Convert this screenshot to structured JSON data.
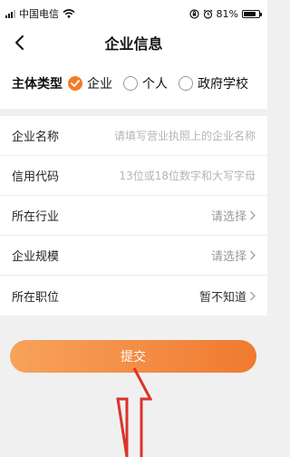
{
  "status_bar": {
    "carrier": "中国电信",
    "battery": "81%",
    "battery_level": 0.81
  },
  "nav": {
    "title": "企业信息",
    "back_icon": "chevron-left-icon"
  },
  "entity_type": {
    "label": "主体类型",
    "options": [
      {
        "label": "企业",
        "checked": true
      },
      {
        "label": "个人",
        "checked": false
      },
      {
        "label": "政府学校",
        "checked": false
      }
    ]
  },
  "form": {
    "company_name": {
      "label": "企业名称",
      "value": "",
      "placeholder": "请填写营业执照上的企业名称"
    },
    "credit_code": {
      "label": "信用代码",
      "value": "",
      "placeholder": "13位或18位数字和大写字母"
    },
    "industry": {
      "label": "所在行业",
      "value": "请选择"
    },
    "scale": {
      "label": "企业规模",
      "value": "请选择"
    },
    "position": {
      "label": "所在职位",
      "value": "暂不知道"
    }
  },
  "submit": {
    "label": "提交"
  },
  "colors": {
    "accent": "#f07d2a",
    "button_start": "#f7a25c",
    "button_end": "#f07a30",
    "arrow": "#d9342b"
  }
}
